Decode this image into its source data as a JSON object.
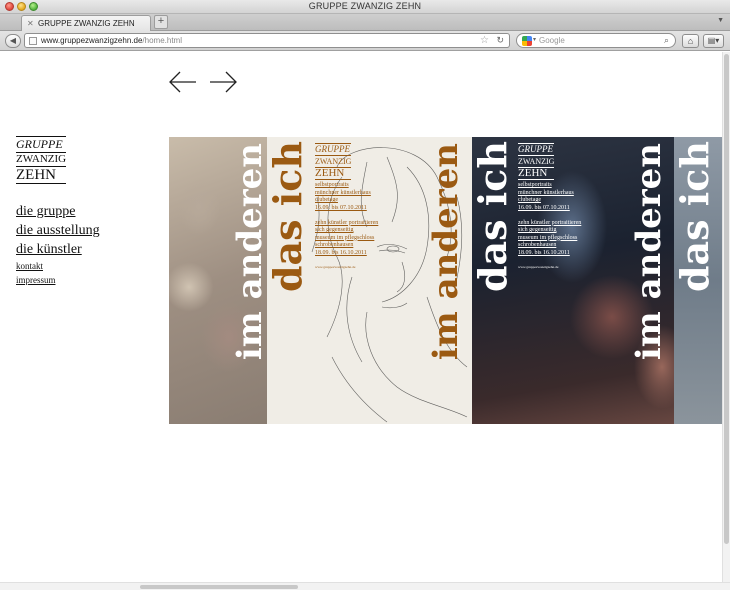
{
  "window": {
    "title": "GRUPPE ZWANZIG ZEHN"
  },
  "tabs": [
    {
      "label": "GRUPPE ZWANZIG ZEHN"
    }
  ],
  "address_bar": {
    "url_host": "www.gruppezwanzigzehn.de",
    "url_path": "/home.html"
  },
  "search_bar": {
    "placeholder": "Google",
    "engine_icon": "google-icon"
  },
  "logo": {
    "line1": "GRUPPE",
    "line2": "ZWANZIG",
    "line3": "ZEHN"
  },
  "nav": {
    "primary": [
      "die gruppe",
      "die ausstellung",
      "die künstler"
    ],
    "secondary": [
      "kontakt",
      "impressum"
    ]
  },
  "posters": {
    "title_a": "das ich",
    "title_b": "im anderen",
    "logo": {
      "line1": "GRUPPE",
      "line2": "ZWANZIG",
      "line3": "ZEHN"
    },
    "brown_text": [
      "selbstportraits",
      "münchner künstlerhaus",
      "clubetage",
      "16.09. bis 07.10.2011",
      "zehn künstler portraitieren",
      "sich gegenseitig",
      "museum im pflegschloss",
      "schrobenhausen",
      "18.09. bis 16.10.2011"
    ],
    "white_text": [
      "selbstportraits",
      "münchner künstlerhaus",
      "clubetage",
      "16.09. bis 07.10.2011",
      "zehn künstler portraitieren",
      "sich gegenseitig",
      "museum im pflegschloss",
      "schrobenhausen",
      "18.09. bis 16.10.2011"
    ],
    "footer_url": "www.gruppezwanzigzehn.de"
  },
  "colors": {
    "brown": "#9b5a12",
    "white": "#ffffff"
  }
}
